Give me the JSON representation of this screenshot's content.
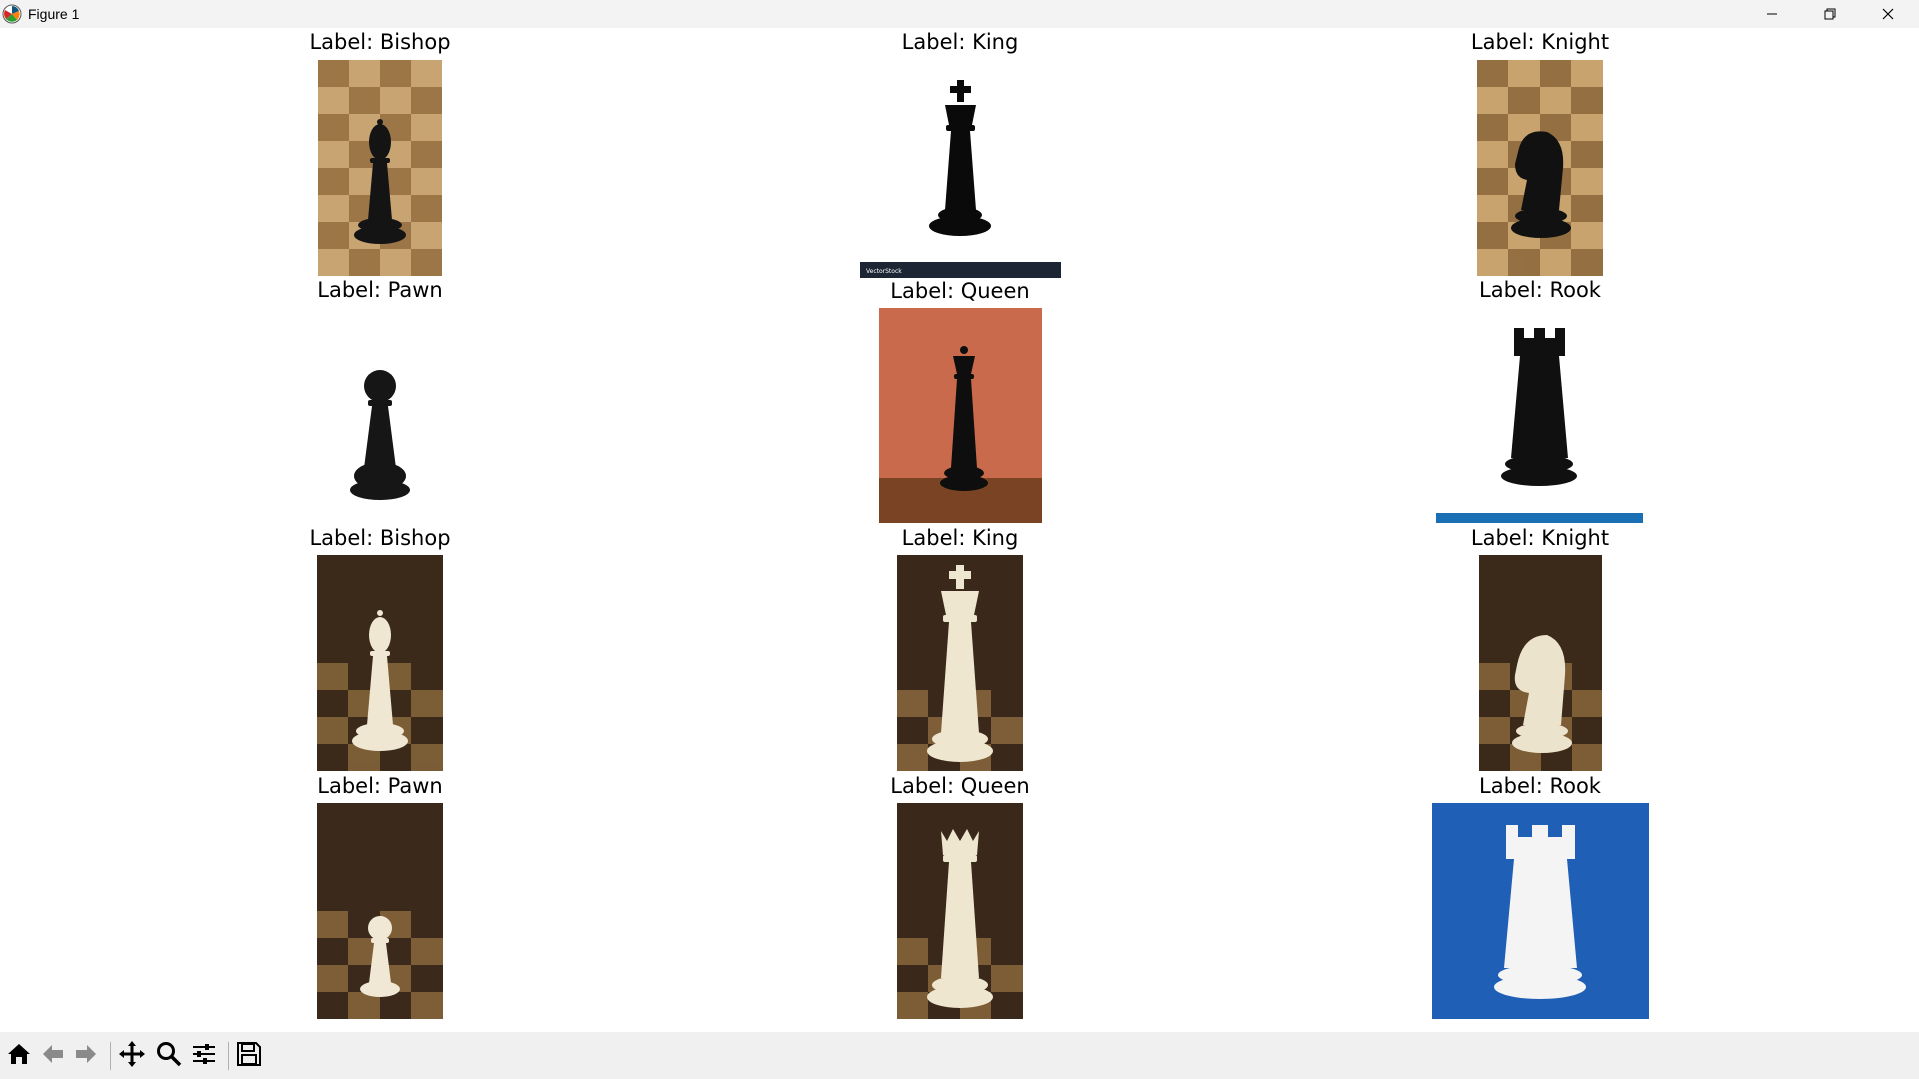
{
  "window": {
    "title": "Figure 1",
    "minimize_icon": "minimize-icon",
    "restore_icon": "restore-icon",
    "close_icon": "close-icon"
  },
  "figure": {
    "cells": [
      {
        "label": "Label: Bishop",
        "piece": "bishop",
        "color": "black",
        "background": "checkerboard-light"
      },
      {
        "label": "Label: King",
        "piece": "king",
        "color": "black",
        "background": "white-vectorstock"
      },
      {
        "label": "Label: Knight",
        "piece": "knight",
        "color": "black",
        "background": "checkerboard-light"
      },
      {
        "label": "Label: Pawn",
        "piece": "pawn",
        "color": "black",
        "background": "white"
      },
      {
        "label": "Label: Queen",
        "piece": "queen",
        "color": "black",
        "background": "orange-wall"
      },
      {
        "label": "Label: Rook",
        "piece": "rook",
        "color": "black",
        "background": "white-watermark"
      },
      {
        "label": "Label: Bishop",
        "piece": "bishop",
        "color": "white",
        "background": "checkerboard-dark"
      },
      {
        "label": "Label: King",
        "piece": "king",
        "color": "white",
        "background": "checkerboard-dark"
      },
      {
        "label": "Label: Knight",
        "piece": "knight",
        "color": "white",
        "background": "checkerboard-dark"
      },
      {
        "label": "Label: Pawn",
        "piece": "pawn",
        "color": "white",
        "background": "checkerboard-dark"
      },
      {
        "label": "Label: Queen",
        "piece": "queen",
        "color": "white",
        "background": "checkerboard-dark"
      },
      {
        "label": "Label: Rook",
        "piece": "rook",
        "color": "white",
        "background": "blue"
      }
    ]
  },
  "toolbar": {
    "buttons": [
      {
        "name": "home-icon"
      },
      {
        "name": "back-icon"
      },
      {
        "name": "forward-icon"
      },
      {
        "name": "pan-icon"
      },
      {
        "name": "zoom-icon"
      },
      {
        "name": "configure-subplots-icon"
      },
      {
        "name": "save-icon"
      }
    ]
  },
  "colors": {
    "titlebar_bg": "#f3f3f3",
    "toolbar_bg": "#f0f0f0",
    "figure_bg": "#ffffff",
    "blue_bg": "#1f5fb5",
    "orange_bg": "#c96a4c"
  }
}
